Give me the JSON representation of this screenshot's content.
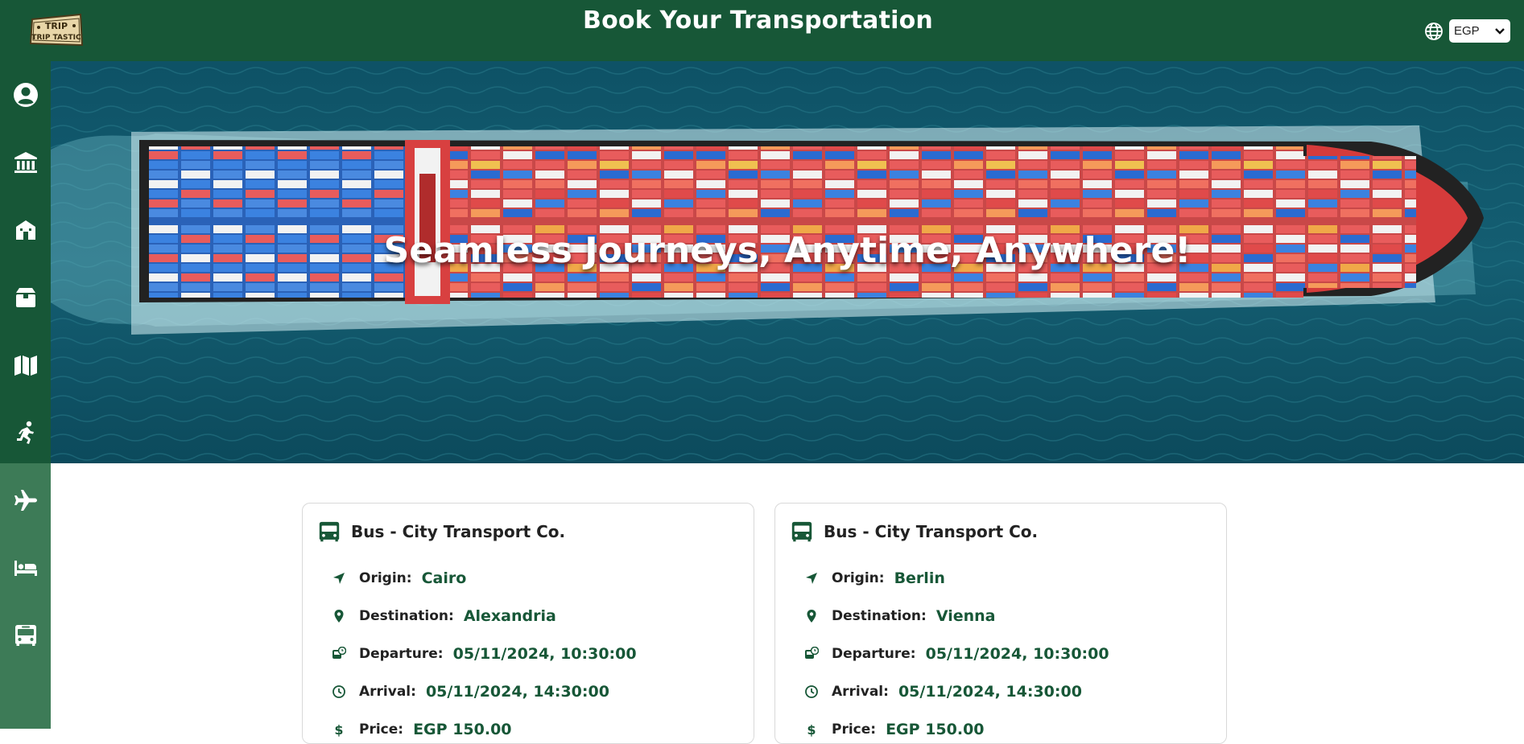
{
  "header": {
    "logo_text": "TRIP TASTIC",
    "title": "Book Your Transportation",
    "currency_selected": "EGP"
  },
  "sidebar": {
    "items": [
      {
        "icon": "user-circle-icon"
      },
      {
        "icon": "museum-icon"
      },
      {
        "icon": "historic-site-icon"
      },
      {
        "icon": "box-icon"
      },
      {
        "icon": "map-icon"
      },
      {
        "icon": "running-icon"
      },
      {
        "icon": "plane-icon"
      },
      {
        "icon": "bed-icon"
      },
      {
        "icon": "bus-icon"
      }
    ]
  },
  "hero": {
    "headline": "Seamless Journeys, Anytime, Anywhere!"
  },
  "cards": [
    {
      "title": "Bus - City Transport Co.",
      "origin_label": "Origin:",
      "origin": "Cairo",
      "destination_label": "Destination:",
      "destination": "Alexandria",
      "departure_label": "Departure:",
      "departure": "05/11/2024, 10:30:00",
      "arrival_label": "Arrival:",
      "arrival": "05/11/2024, 14:30:00",
      "price_label": "Price:",
      "price": "EGP 150.00"
    },
    {
      "title": "Bus - City Transport Co.",
      "origin_label": "Origin:",
      "origin": "Berlin",
      "destination_label": "Destination:",
      "destination": "Vienna",
      "departure_label": "Departure:",
      "departure": "05/11/2024, 10:30:00",
      "arrival_label": "Arrival:",
      "arrival": "05/11/2024, 14:30:00",
      "price_label": "Price:",
      "price": "EGP 150.00"
    }
  ],
  "colors": {
    "brand_green": "#175737",
    "active_green": "#3f7b58",
    "value_green": "#175737"
  }
}
